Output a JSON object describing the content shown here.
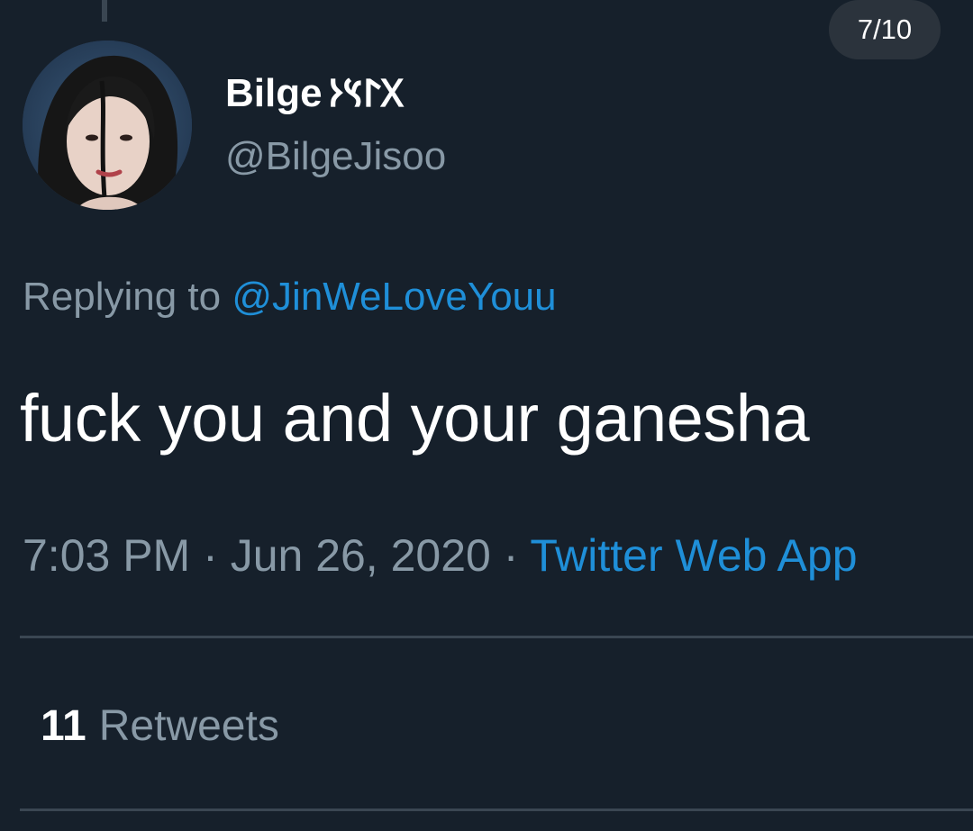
{
  "viewer": {
    "counter": "7/10"
  },
  "tweet": {
    "author": {
      "display_name": "Bilge",
      "name_glyphs": "𐰓𐰃𐰽𐰆",
      "handle": "@BilgeJisoo"
    },
    "reply": {
      "prefix": "Replying to",
      "mention": "@JinWeLoveYouu"
    },
    "text": "fuck you and your ganesha",
    "meta": {
      "time": "7:03 PM",
      "separator": "·",
      "date": "Jun 26, 2020",
      "source": "Twitter Web App"
    },
    "stats": {
      "retweets_count": "11",
      "retweets_label": "Retweets"
    }
  },
  "colors": {
    "background": "#16202b",
    "text_primary": "#ffffff",
    "text_secondary": "#8899a6",
    "link": "#1f8fd8",
    "divider": "#3a4652"
  },
  "icons": {
    "avatar": "profile-photo"
  }
}
